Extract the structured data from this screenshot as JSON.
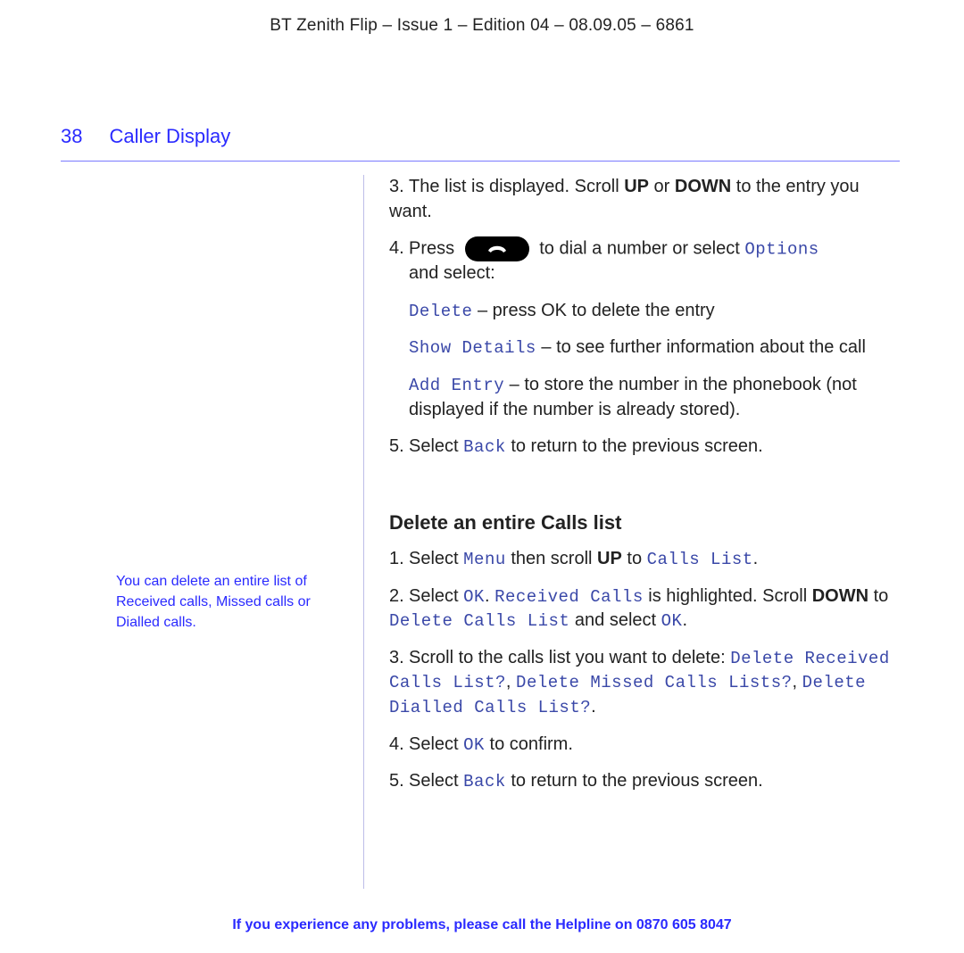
{
  "header": "BT Zenith Flip – Issue 1 – Edition 04 – 08.09.05 – 6861",
  "page_number": "38",
  "section_title": "Caller Display",
  "sidenote": "You can delete an entire list of Received calls, Missed calls or Dialled calls.",
  "body": {
    "p3_a": "3.",
    "p3_b": "The list is displayed. Scroll ",
    "p3_up": "UP",
    "p3_c": " or ",
    "p3_down": "DOWN",
    "p3_d": " to the entry you want.",
    "p4_a": "4.",
    "p4_b": "Press ",
    "p4_c": " to dial a number or select ",
    "p4_options": "Options",
    "p4_d": " and select:",
    "opt1_kw": "Delete",
    "opt1_t": " – press OK to delete the entry",
    "opt2_kw": "Show Details",
    "opt2_t": " – to see further information about the call",
    "opt3_kw": "Add Entry",
    "opt3_t": " – to store the number in the phonebook (not displayed if the number is already stored).",
    "p5_a": "5.",
    "p5_b": "Select ",
    "p5_kw": "Back",
    "p5_c": " to return to the previous screen.",
    "sub": "Delete an entire Calls list",
    "d1_a": "1.",
    "d1_b": "Select ",
    "d1_menu": "Menu",
    "d1_c": " then scroll ",
    "d1_up": "UP",
    "d1_d": " to ",
    "d1_cl": "Calls List",
    "d1_e": ".",
    "d2_a": "2.",
    "d2_b": "Select ",
    "d2_ok": "OK",
    "d2_c": ". ",
    "d2_rc": "Received Calls",
    "d2_d": " is highlighted. Scroll ",
    "d2_down": "DOWN",
    "d2_e": " to ",
    "d2_dcl": "Delete Calls List",
    "d2_f": " and select ",
    "d2_ok2": "OK",
    "d2_g": ".",
    "d3_a": "3.",
    "d3_b": "Scroll to the calls list you want to delete: ",
    "d3_k1": "Delete Received Calls List?",
    "d3_c": ", ",
    "d3_k2": "Delete Missed Calls Lists?",
    "d3_d": ", ",
    "d3_k3": "Delete Dialled Calls List?",
    "d3_e": ".",
    "d4_a": "4.",
    "d4_b": "Select ",
    "d4_ok": "OK",
    "d4_c": " to confirm.",
    "d5_a": "5.",
    "d5_b": "Select ",
    "d5_kw": "Back",
    "d5_c": " to return to the previous screen."
  },
  "footer_a": "If you experience any problems, please call the Helpline on ",
  "footer_phone": "0870 605 8047"
}
